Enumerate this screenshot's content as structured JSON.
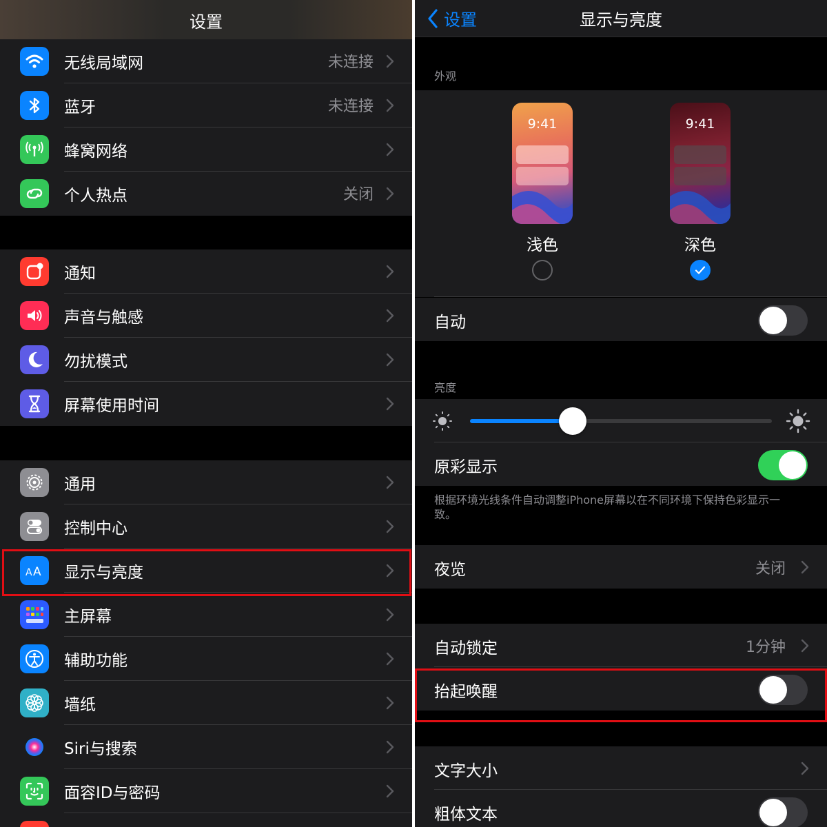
{
  "left": {
    "header_title": "设置",
    "groups": [
      [
        {
          "label": "无线局域网",
          "value": "未连接",
          "icon": "wifi-icon",
          "color": "#0a84ff"
        },
        {
          "label": "蓝牙",
          "value": "未连接",
          "icon": "bluetooth-icon",
          "color": "#0a84ff"
        },
        {
          "label": "蜂窝网络",
          "value": "",
          "icon": "cellular-icon",
          "color": "#34c759"
        },
        {
          "label": "个人热点",
          "value": "关闭",
          "icon": "hotspot-icon",
          "color": "#34c759"
        }
      ],
      [
        {
          "label": "通知",
          "value": "",
          "icon": "notifications-icon",
          "color": "#ff3b30"
        },
        {
          "label": "声音与触感",
          "value": "",
          "icon": "sound-icon",
          "color": "#ff2d55"
        },
        {
          "label": "勿扰模式",
          "value": "",
          "icon": "moon-icon",
          "color": "#5e5ce6"
        },
        {
          "label": "屏幕使用时间",
          "value": "",
          "icon": "hourglass-icon",
          "color": "#5e5ce6"
        }
      ],
      [
        {
          "label": "通用",
          "value": "",
          "icon": "gear-icon",
          "color": "#8e8e93"
        },
        {
          "label": "控制中心",
          "value": "",
          "icon": "control-center-icon",
          "color": "#8e8e93"
        },
        {
          "label": "显示与亮度",
          "value": "",
          "icon": "display-brightness-icon",
          "color": "#0a84ff"
        },
        {
          "label": "主屏幕",
          "value": "",
          "icon": "home-screen-icon",
          "color": "#2c5bff"
        },
        {
          "label": "辅助功能",
          "value": "",
          "icon": "accessibility-icon",
          "color": "#0a84ff"
        },
        {
          "label": "墙纸",
          "value": "",
          "icon": "wallpaper-icon",
          "color": "#30b0c7"
        },
        {
          "label": "Siri与搜索",
          "value": "",
          "icon": "siri-icon",
          "color": "#1c1c1e"
        },
        {
          "label": "面容ID与密码",
          "value": "",
          "icon": "face-id-icon",
          "color": "#34c759"
        },
        {
          "label": "",
          "value": "",
          "icon": "sos-icon",
          "color": "#ff3b30"
        }
      ]
    ]
  },
  "right": {
    "back_label": "设置",
    "header_title": "显示与亮度",
    "appearance_label": "外观",
    "light_label": "浅色",
    "dark_label": "深色",
    "phone_time": "9:41",
    "selected_mode": "dark",
    "auto_label": "自动",
    "auto_on": false,
    "brightness_label": "亮度",
    "brightness_level": 0.34,
    "true_tone_label": "原彩显示",
    "true_tone_on": true,
    "true_tone_note": "根据环境光线条件自动调整iPhone屏幕以在不同环境下保持色彩显示一致。",
    "night_shift_label": "夜览",
    "night_shift_value": "关闭",
    "auto_lock_label": "自动锁定",
    "auto_lock_value": "1分钟",
    "raise_to_wake_label": "抬起唤醒",
    "raise_to_wake_on": false,
    "text_size_label": "文字大小",
    "bold_text_label": "粗体文本",
    "bold_text_on": false
  },
  "colors": {
    "accent": "#0a84ff",
    "highlight": "#e10e14",
    "toggle_on": "#30d158"
  }
}
